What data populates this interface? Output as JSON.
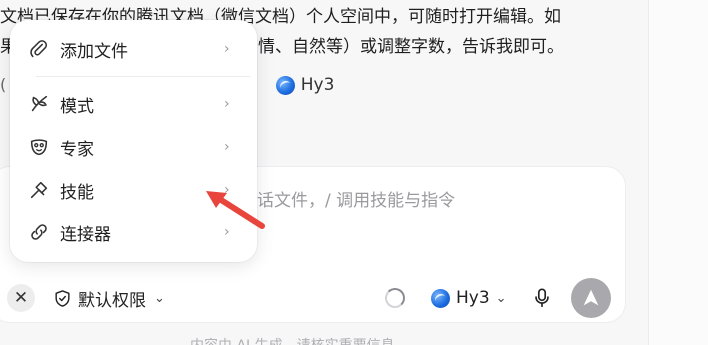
{
  "conversation": {
    "line1": "文档已保存在你的腾讯文档（微信文档）个人空间中，可随时打开编辑。如",
    "line2_left": "果",
    "line2_right": "情、自然等）或调整字数，告诉我即可。",
    "bracket_char": "(",
    "model_name": "Hy3"
  },
  "attach_menu": {
    "items": [
      {
        "label": "添加文件",
        "icon": "paperclip-icon"
      },
      {
        "label": "模式",
        "icon": "mode-icon"
      },
      {
        "label": "专家",
        "icon": "expert-icon"
      },
      {
        "label": "技能",
        "icon": "skill-icon"
      },
      {
        "label": "连接器",
        "icon": "link-icon"
      }
    ],
    "chevron": "›"
  },
  "composer": {
    "placeholder": "话文件，/ 调用技能与指令",
    "permission_label": "默认权限",
    "model_label": "Hy3",
    "close_glyph": "✕",
    "chevron_down": "⌄"
  },
  "footer": {
    "note": "内容由 AI 生成，请核实重要信息"
  },
  "colors": {
    "accent_red": "#e8453c",
    "send_button": "#a9a9ad",
    "globe_blue": "#1f6fe0"
  }
}
